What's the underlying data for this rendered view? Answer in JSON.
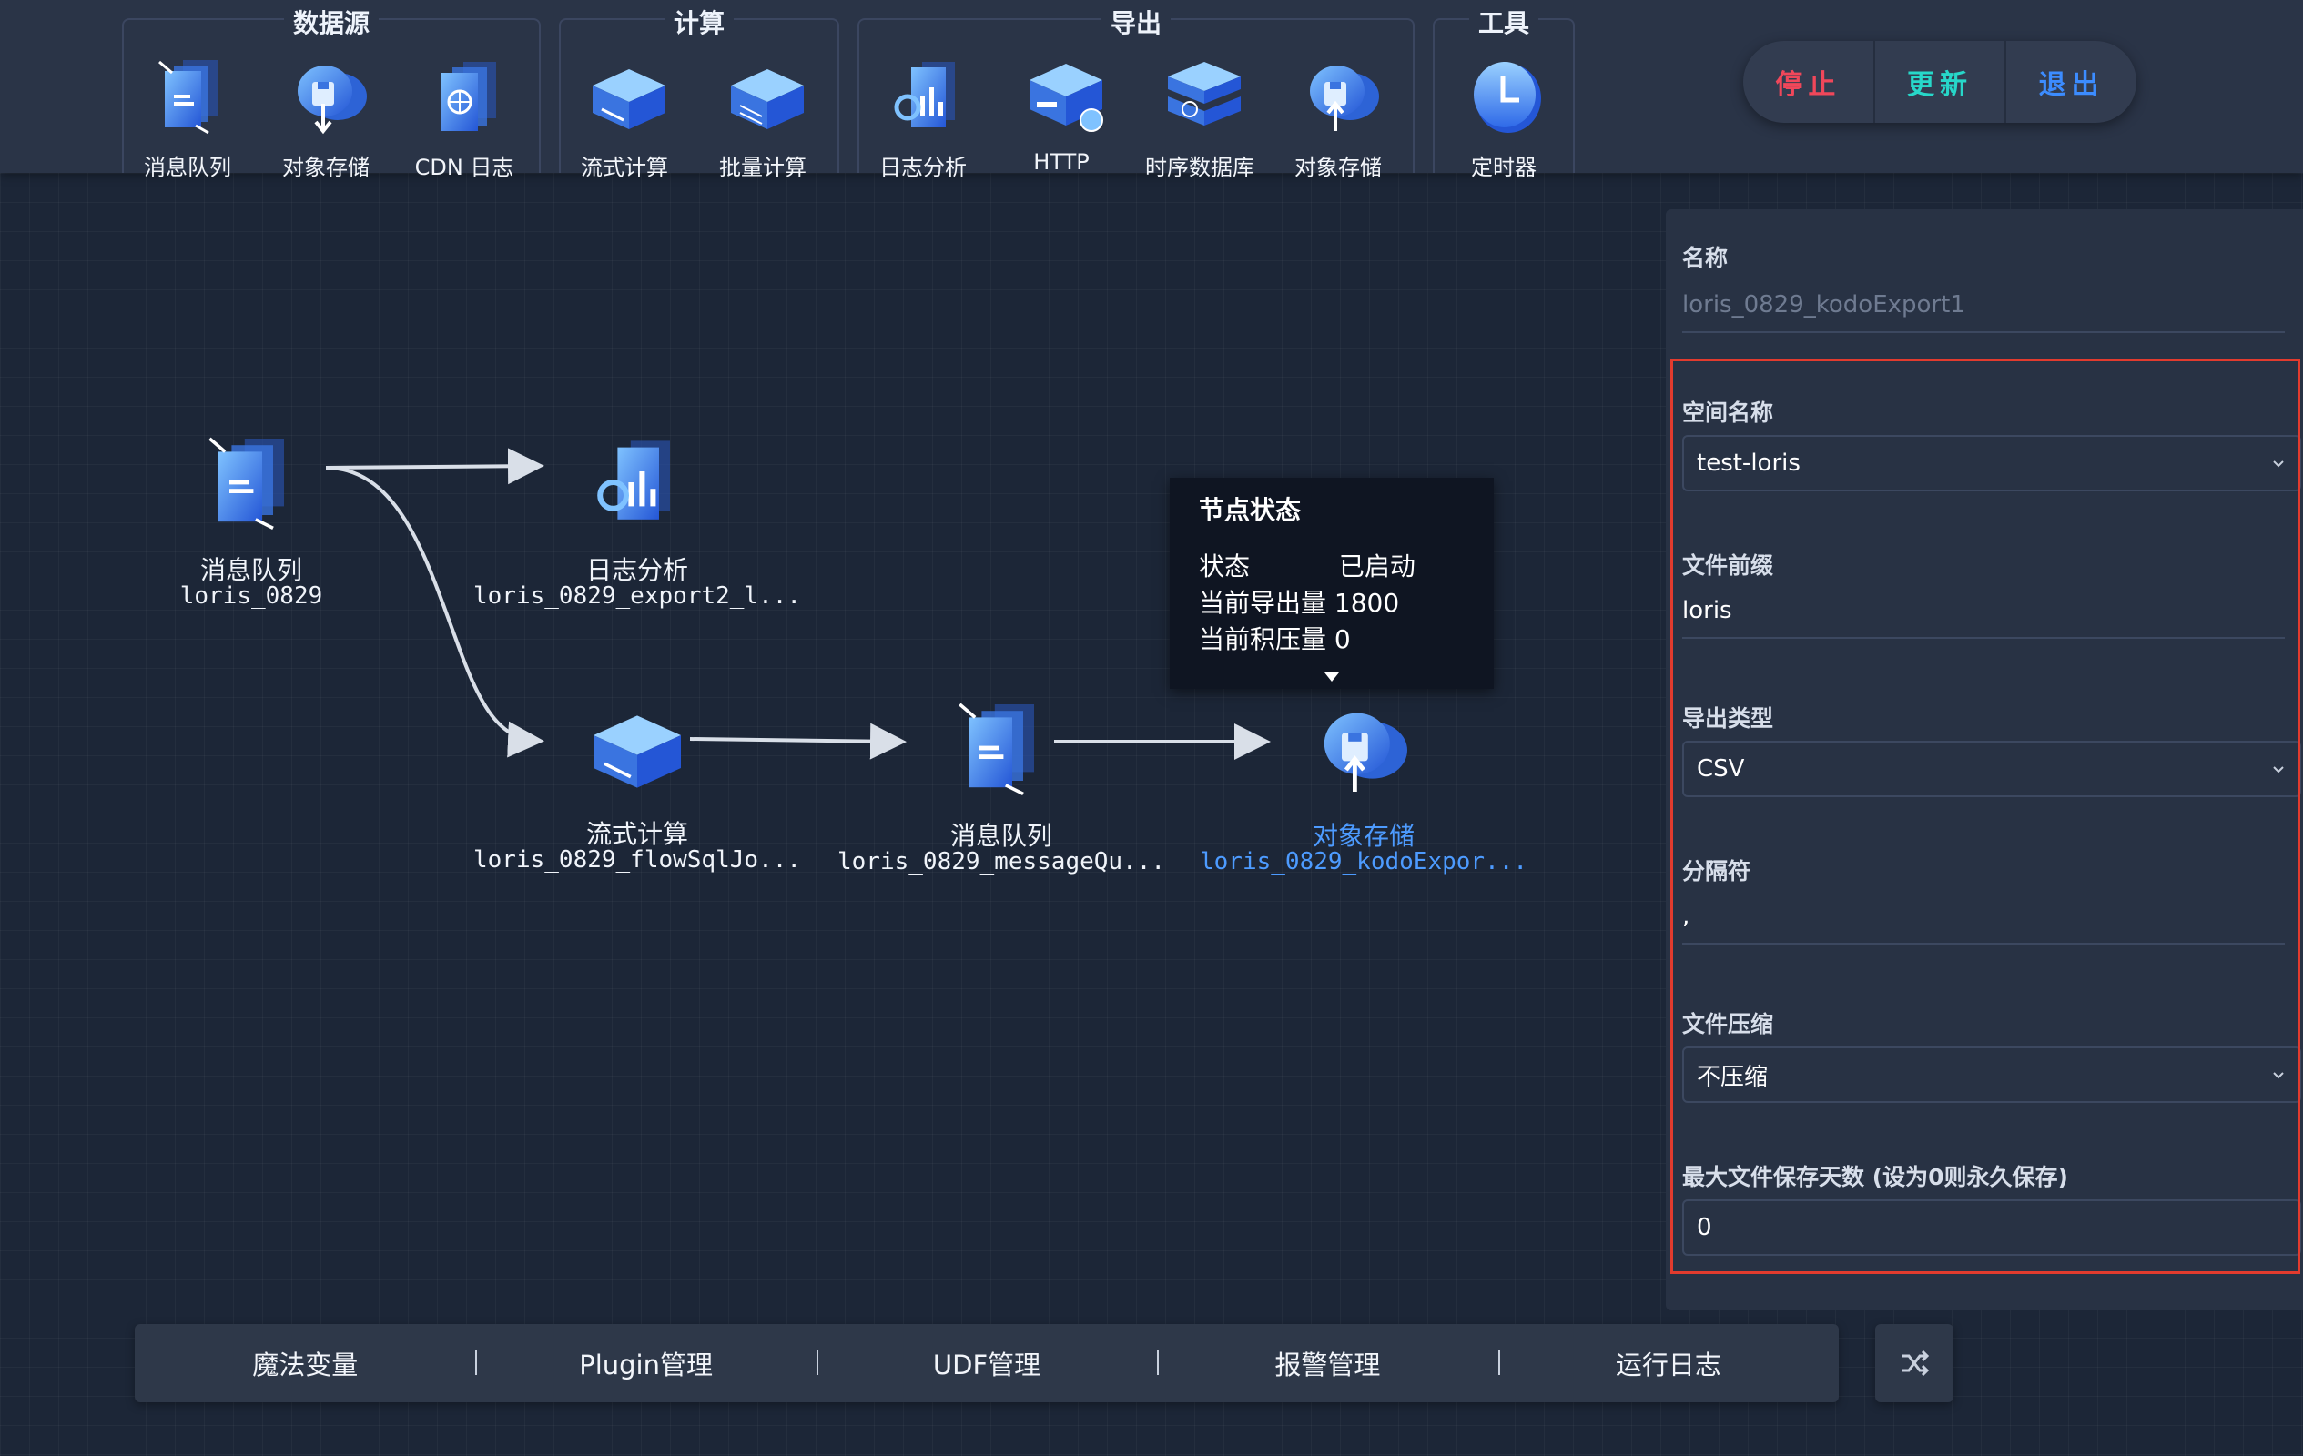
{
  "toolbar": {
    "groups": [
      {
        "title": "数据源",
        "tools": [
          "消息队列",
          "对象存储",
          "CDN 日志"
        ]
      },
      {
        "title": "计算",
        "tools": [
          "流式计算",
          "批量计算"
        ]
      },
      {
        "title": "导出",
        "tools": [
          "日志分析",
          "HTTP",
          "时序数据库",
          "对象存储"
        ]
      },
      {
        "title": "工具",
        "tools": [
          "定时器"
        ]
      }
    ],
    "controls": {
      "stop": "停止",
      "update": "更新",
      "exit": "退出"
    }
  },
  "graph": {
    "nodes": [
      {
        "type": "消息队列",
        "name": "loris_0829"
      },
      {
        "type": "日志分析",
        "name": "loris_0829_export2_l..."
      },
      {
        "type": "流式计算",
        "name": "loris_0829_flowSqlJo..."
      },
      {
        "type": "消息队列",
        "name": "loris_0829_messageQu..."
      },
      {
        "type": "对象存储",
        "name": "loris_0829_kodoExpor..."
      }
    ],
    "tooltip": {
      "title": "节点状态",
      "status_label": "状态",
      "status_value": "已启动",
      "export_label": "当前导出量",
      "export_value": "1800",
      "backlog_label": "当前积压量",
      "backlog_value": "0"
    }
  },
  "panel": {
    "name_label": "名称",
    "name_value": "loris_0829_kodoExport1",
    "bucket_label": "空间名称",
    "bucket_value": "test-loris",
    "prefix_label": "文件前缀",
    "prefix_value": "loris",
    "export_type_label": "导出类型",
    "export_type_value": "CSV",
    "delimiter_label": "分隔符",
    "delimiter_value": ",",
    "compress_label": "文件压缩",
    "compress_value": "不压缩",
    "retention_label": "最大文件保存天数 (设为0则永久保存)",
    "retention_value": "0"
  },
  "bottom": {
    "items": [
      "魔法变量",
      "Plugin管理",
      "UDF管理",
      "报警管理",
      "运行日志"
    ]
  },
  "colors": {
    "stop": "#f0475a",
    "update": "#27d7c9",
    "exit": "#3c8cff",
    "highlight": "#e23b2e",
    "active_node": "#4d9bff"
  }
}
